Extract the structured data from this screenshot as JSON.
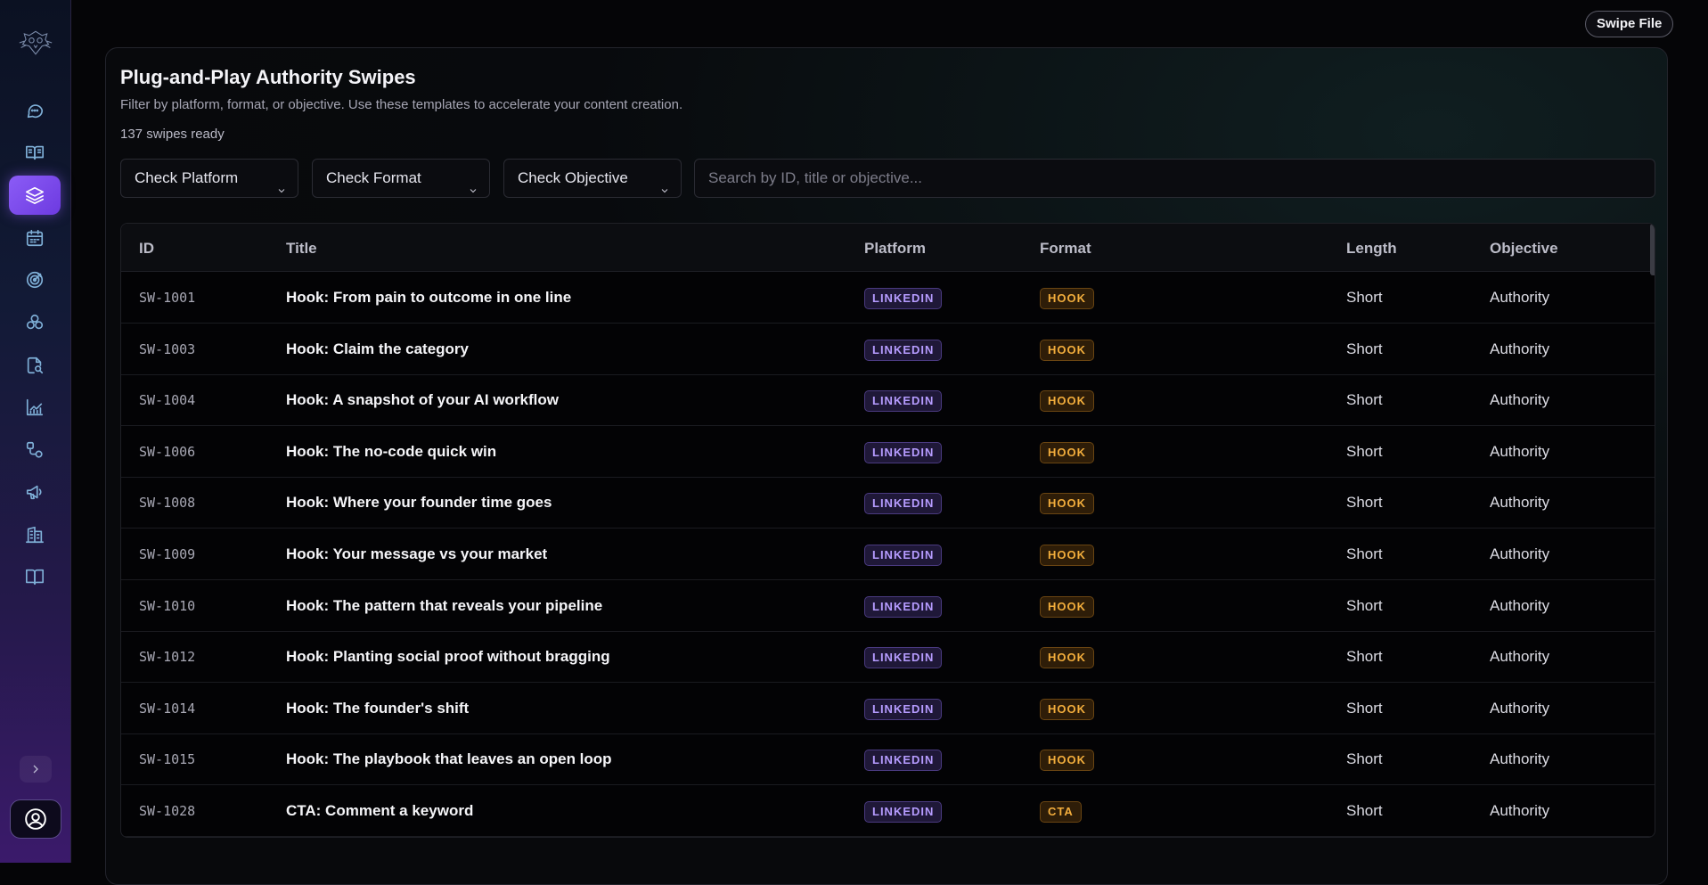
{
  "top_bar": {
    "swipe_file_label": "Swipe File"
  },
  "sidebar": {
    "items": [
      {
        "icon": "chat-icon",
        "active": false
      },
      {
        "icon": "book-open-icon",
        "active": false
      },
      {
        "icon": "layers-icon",
        "active": true
      },
      {
        "icon": "calendar-icon",
        "active": false
      },
      {
        "icon": "target-icon",
        "active": false
      },
      {
        "icon": "circles-icon",
        "active": false
      },
      {
        "icon": "file-search-icon",
        "active": false
      },
      {
        "icon": "line-chart-icon",
        "active": false
      },
      {
        "icon": "workflow-icon",
        "active": false
      },
      {
        "icon": "megaphone-icon",
        "active": false
      },
      {
        "icon": "building-icon",
        "active": false
      },
      {
        "icon": "book-icon",
        "active": false
      }
    ],
    "accent_color": "#8b5cf6"
  },
  "header": {
    "title": "Plug-and-Play Authority Swipes",
    "subtitle": "Filter by platform, format, or objective. Use these templates to accelerate your content creation.",
    "count": "137 swipes ready"
  },
  "filters": {
    "platform": "Check Platform",
    "format": "Check Format",
    "objective": "Check Objective",
    "search_placeholder": "Search by ID, title or objective..."
  },
  "table": {
    "columns": [
      "ID",
      "Title",
      "Platform",
      "Format",
      "Length",
      "Objective"
    ],
    "rows": [
      {
        "id": "SW-1001",
        "title": "Hook: From pain to outcome in one line",
        "platform": "LINKEDIN",
        "format": "HOOK",
        "length": "Short",
        "objective": "Authority"
      },
      {
        "id": "SW-1003",
        "title": "Hook: Claim the category",
        "platform": "LINKEDIN",
        "format": "HOOK",
        "length": "Short",
        "objective": "Authority"
      },
      {
        "id": "SW-1004",
        "title": "Hook: A snapshot of your AI workflow",
        "platform": "LINKEDIN",
        "format": "HOOK",
        "length": "Short",
        "objective": "Authority"
      },
      {
        "id": "SW-1006",
        "title": "Hook: The no-code quick win",
        "platform": "LINKEDIN",
        "format": "HOOK",
        "length": "Short",
        "objective": "Authority"
      },
      {
        "id": "SW-1008",
        "title": "Hook: Where your founder time goes",
        "platform": "LINKEDIN",
        "format": "HOOK",
        "length": "Short",
        "objective": "Authority"
      },
      {
        "id": "SW-1009",
        "title": "Hook: Your message vs your market",
        "platform": "LINKEDIN",
        "format": "HOOK",
        "length": "Short",
        "objective": "Authority"
      },
      {
        "id": "SW-1010",
        "title": "Hook: The pattern that reveals your pipeline",
        "platform": "LINKEDIN",
        "format": "HOOK",
        "length": "Short",
        "objective": "Authority"
      },
      {
        "id": "SW-1012",
        "title": "Hook: Planting social proof without bragging",
        "platform": "LINKEDIN",
        "format": "HOOK",
        "length": "Short",
        "objective": "Authority"
      },
      {
        "id": "SW-1014",
        "title": "Hook: The founder's shift",
        "platform": "LINKEDIN",
        "format": "HOOK",
        "length": "Short",
        "objective": "Authority"
      },
      {
        "id": "SW-1015",
        "title": "Hook: The playbook that leaves an open loop",
        "platform": "LINKEDIN",
        "format": "HOOK",
        "length": "Short",
        "objective": "Authority"
      },
      {
        "id": "SW-1028",
        "title": "CTA: Comment a keyword",
        "platform": "LINKEDIN",
        "format": "CTA",
        "length": "Short",
        "objective": "Authority"
      }
    ]
  }
}
